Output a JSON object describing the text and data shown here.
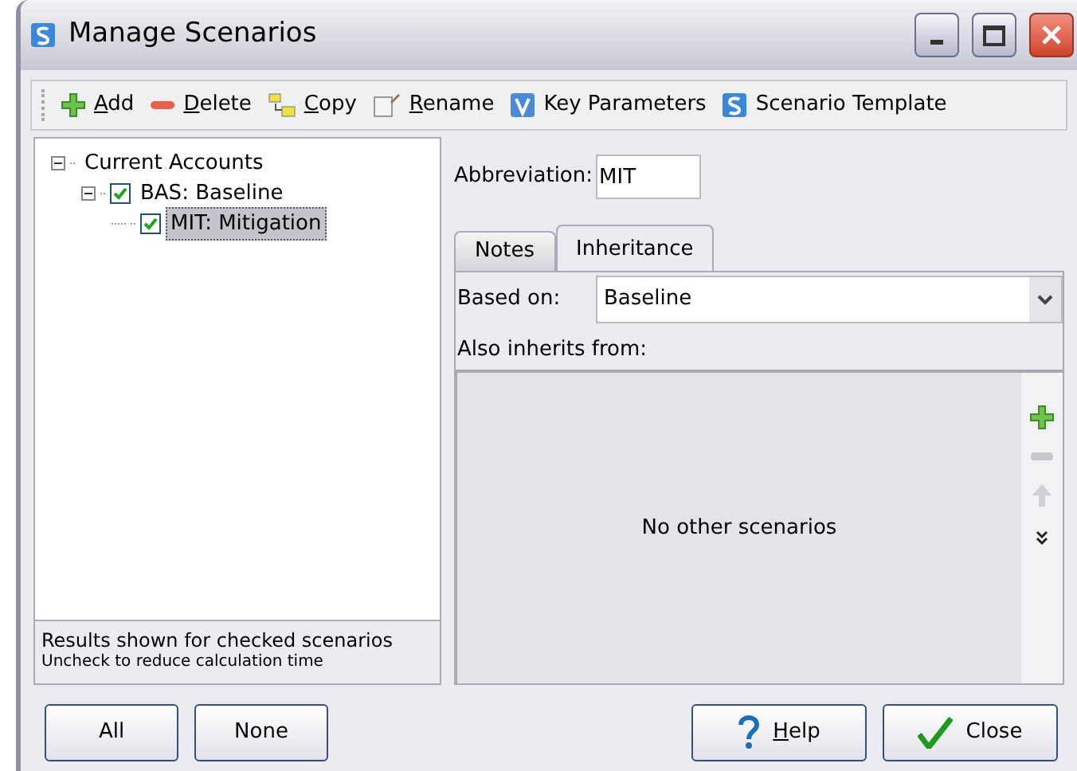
{
  "window": {
    "title": "Manage Scenarios"
  },
  "toolbar": [
    {
      "kind": "add",
      "label": "Add",
      "mnemonic": true
    },
    {
      "kind": "delete",
      "label": "Delete",
      "mnemonic": true
    },
    {
      "kind": "copy",
      "label": "Copy",
      "mnemonic": true
    },
    {
      "kind": "rename",
      "label": "Rename",
      "mnemonic": true
    },
    {
      "kind": "v",
      "label": "Key Parameters",
      "mnemonic": false
    },
    {
      "kind": "s",
      "label": "Scenario Template",
      "mnemonic": false
    }
  ],
  "tree": [
    {
      "label": "Current Accounts",
      "expanded": true,
      "children": [
        {
          "label": "BAS: Baseline",
          "checked": true,
          "expanded": true,
          "selected": false,
          "children": [
            {
              "label": "MIT: Mitigation",
              "checked": true,
              "selected": true
            }
          ]
        }
      ]
    }
  ],
  "tree_note": {
    "line_1": "Results shown for checked scenarios",
    "line_2": "Uncheck to reduce calculation time"
  },
  "abbreviation": {
    "label": "Abbreviation:",
    "value": "MIT"
  },
  "tabs": [
    {
      "label": "Notes",
      "selected": false
    },
    {
      "label": "Inheritance",
      "selected": true
    }
  ],
  "based_on": {
    "label": "Based on:",
    "value": "Baseline"
  },
  "inherits": {
    "label": "Also inherits from:",
    "empty_text": "No other scenarios"
  },
  "left_buttons": [
    {
      "label": "All"
    },
    {
      "label": "None"
    }
  ],
  "right_buttons": [
    {
      "kind": "help",
      "label": "Help",
      "mnemonic": true
    },
    {
      "kind": "close",
      "label": "Close",
      "mnemonic": false
    }
  ]
}
